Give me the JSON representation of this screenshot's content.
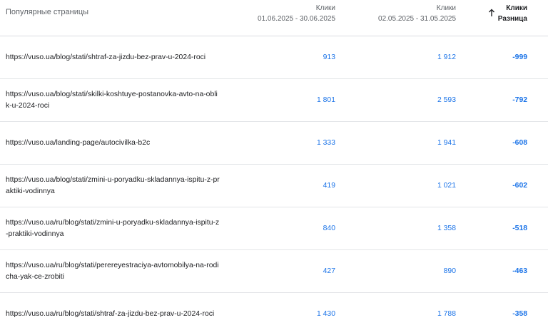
{
  "header": {
    "page_col": "Популярные страницы",
    "col1_title": "Клики",
    "col1_range": "01.06.2025 - 30.06.2025",
    "col2_title": "Клики",
    "col2_range": "02.05.2025 - 31.05.2025",
    "diff_title": "Клики",
    "diff_sub": "Разница",
    "sort_icon": "arrow-up-icon"
  },
  "colors": {
    "link_blue": "#1a73e8",
    "text": "#202124",
    "muted": "#5f6368",
    "divider": "#e3e5e8"
  },
  "rows": [
    {
      "url": "https://vuso.ua/blog/stati/shtraf-za-jizdu-bez-prav-u-2024-roci",
      "clicks_current": "913",
      "clicks_previous": "1 912",
      "diff": "-999"
    },
    {
      "url": "https://vuso.ua/blog/stati/skilki-koshtuye-postanovka-avto-na-oblik-u-2024-roci",
      "clicks_current": "1 801",
      "clicks_previous": "2 593",
      "diff": "-792"
    },
    {
      "url": "https://vuso.ua/landing-page/autocivilka-b2c",
      "clicks_current": "1 333",
      "clicks_previous": "1 941",
      "diff": "-608"
    },
    {
      "url": "https://vuso.ua/blog/stati/zmini-u-poryadku-skladannya-ispitu-z-praktiki-vodinnya",
      "clicks_current": "419",
      "clicks_previous": "1 021",
      "diff": "-602"
    },
    {
      "url": "https://vuso.ua/ru/blog/stati/zmini-u-poryadku-skladannya-ispitu-z-praktiki-vodinnya",
      "clicks_current": "840",
      "clicks_previous": "1 358",
      "diff": "-518"
    },
    {
      "url": "https://vuso.ua/ru/blog/stati/perereyestraciya-avtomobilya-na-rodicha-yak-ce-zrobiti",
      "clicks_current": "427",
      "clicks_previous": "890",
      "diff": "-463"
    },
    {
      "url": "https://vuso.ua/ru/blog/stati/shtraf-za-jizdu-bez-prav-u-2024-roci",
      "clicks_current": "1 430",
      "clicks_previous": "1 788",
      "diff": "-358"
    }
  ]
}
